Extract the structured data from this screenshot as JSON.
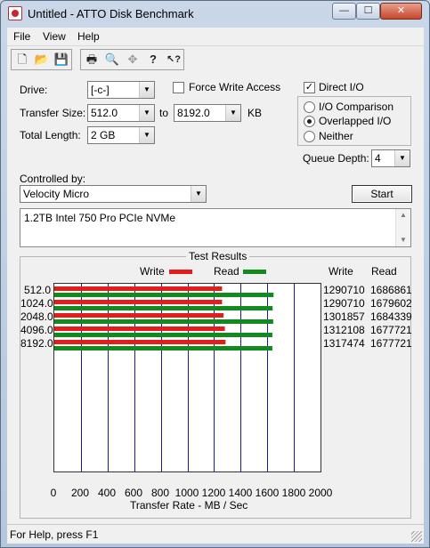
{
  "window": {
    "title": "Untitled - ATTO Disk Benchmark",
    "min_glyph": "—",
    "max_glyph": "☐",
    "close_glyph": "✕"
  },
  "menu": {
    "items": [
      "File",
      "View",
      "Help"
    ]
  },
  "toolbar": {
    "buttons": [
      {
        "icon": "new-document-icon",
        "glyph": "🗋"
      },
      {
        "icon": "open-folder-icon",
        "glyph": "📂"
      },
      {
        "icon": "save-icon",
        "glyph": "💾"
      },
      {
        "icon": "print-icon",
        "glyph": "🖶"
      },
      {
        "icon": "print-preview-icon",
        "glyph": "🔍"
      },
      {
        "icon": "move-icon",
        "glyph": "✥"
      },
      {
        "icon": "help-icon",
        "glyph": "?"
      },
      {
        "icon": "context-help-icon",
        "glyph": "↖?"
      }
    ]
  },
  "settings": {
    "drive_label": "Drive:",
    "drive_value": "[-c-]",
    "transfer_size_label": "Transfer Size:",
    "transfer_size_from": "512.0",
    "to_label": "to",
    "transfer_size_to": "8192.0",
    "kb_label": "KB",
    "total_length_label": "Total Length:",
    "total_length_value": "2 GB",
    "force_write_access_label": "Force Write Access",
    "force_write_access_checked": false,
    "direct_io_label": "Direct I/O",
    "direct_io_checked": true,
    "io_options": [
      {
        "label": "I/O Comparison",
        "selected": false
      },
      {
        "label": "Overlapped I/O",
        "selected": true
      },
      {
        "label": "Neither",
        "selected": false
      }
    ],
    "queue_depth_label": "Queue Depth:",
    "queue_depth_value": "4",
    "controlled_by_label": "Controlled by:",
    "controlled_by_value": "Velocity Micro",
    "start_label": "Start",
    "description": "1.2TB Intel 750 Pro PCIe NVMe"
  },
  "results": {
    "title": "Test Results",
    "legend_write": "Write",
    "legend_read": "Read",
    "col_write": "Write",
    "col_read": "Read",
    "xlabel": "Transfer Rate - MB / Sec",
    "write_color": "#e41c1c",
    "read_color": "#138a1e",
    "grid_color": "#1d1d8f"
  },
  "chart_data": {
    "type": "bar",
    "orientation": "horizontal",
    "categories": [
      "512.0",
      "1024.0",
      "2048.0",
      "4096.0",
      "8192.0"
    ],
    "series": [
      {
        "name": "Write",
        "values": [
          1290710,
          1290710,
          1301857,
          1312108,
          1317474
        ]
      },
      {
        "name": "Read",
        "values": [
          1686861,
          1679602,
          1684339,
          1677721,
          1677721
        ]
      }
    ],
    "xlim": [
      0,
      2000
    ],
    "xticks": [
      0,
      200,
      400,
      600,
      800,
      1000,
      1200,
      1400,
      1600,
      1800,
      2000
    ],
    "xlabel": "Transfer Rate - MB / Sec"
  },
  "status": {
    "text": "For Help, press F1"
  }
}
